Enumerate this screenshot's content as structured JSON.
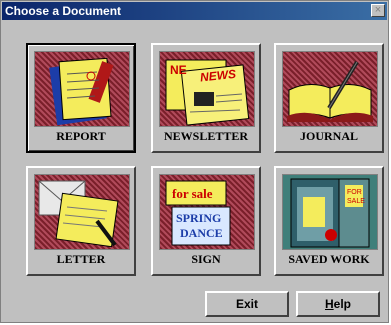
{
  "window": {
    "title": "Choose a Document",
    "close_glyph": "×"
  },
  "tiles": [
    {
      "label": "REPORT"
    },
    {
      "label": "NEWSLETTER",
      "art_text": [
        "NE",
        "NEWS"
      ]
    },
    {
      "label": "JOURNAL"
    },
    {
      "label": "LETTER"
    },
    {
      "label": "SIGN",
      "art_text": [
        "for sale",
        "SPRING",
        "DANCE"
      ]
    },
    {
      "label": "SAVED WORK",
      "art_text": [
        "FOR",
        "SALE"
      ]
    }
  ],
  "buttons": {
    "exit": "Exit",
    "help_first": "H",
    "help_rest": "elp"
  },
  "selected_tile": 0
}
